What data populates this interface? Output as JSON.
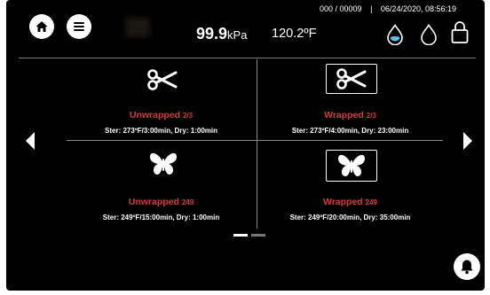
{
  "status_bar": {
    "counter": "000 / 00009",
    "separator": "|",
    "datetime": "06/24/2020, 08:56:19"
  },
  "readouts": {
    "pressure_value": "99.9",
    "pressure_unit": "kPa",
    "temperature": "120.2ºF"
  },
  "cycles": [
    {
      "name": "Unwrapped",
      "count": "2/3",
      "params": "Ster: 273ºF/3:00min, Dry: 1:00min",
      "icon": "scissors-icon"
    },
    {
      "name": "Wrapped",
      "count": "2/3",
      "params": "Ster: 273ºF/4:00min, Dry: 23:00min",
      "icon": "scissors-icon"
    },
    {
      "name": "Unwrapped",
      "count": "249",
      "params": "Ster: 249ºF/15:00min, Dry: 1:00min",
      "icon": "butterfly-icon"
    },
    {
      "name": "Wrapped",
      "count": "249",
      "params": "Ster: 249ºF/20:00min, Dry: 35:00min",
      "icon": "butterfly-icon"
    }
  ],
  "pagination": {
    "current_page": 1,
    "total_pages": 2
  },
  "colors": {
    "background": "#000000",
    "accent_red": "#d93a3a",
    "foreground": "#ffffff"
  }
}
